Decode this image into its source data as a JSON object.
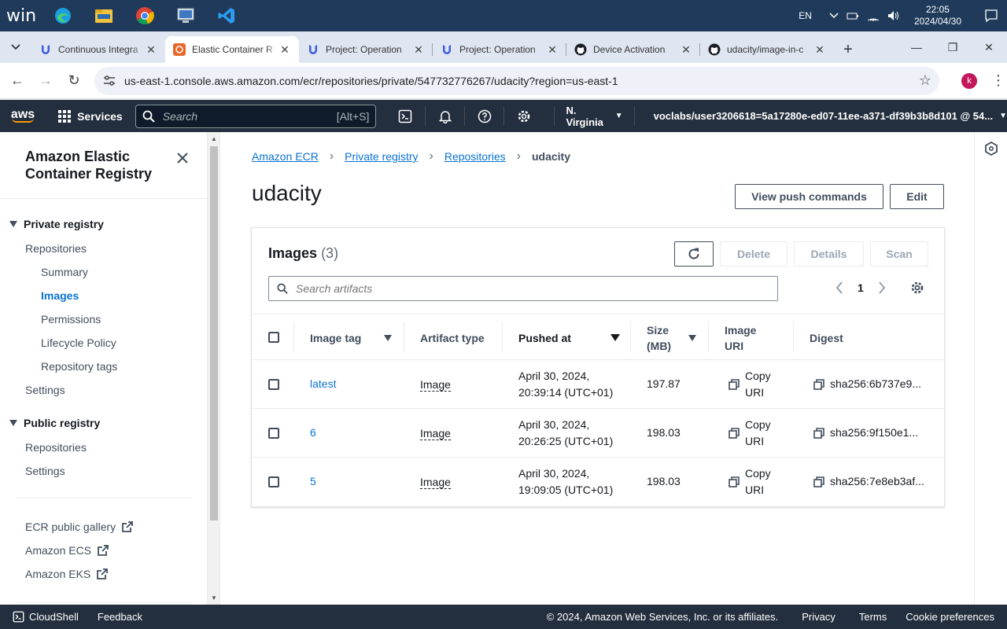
{
  "taskbar": {
    "logo": "win",
    "lang": "EN",
    "time": "22:05",
    "date": "2024/04/30"
  },
  "tabs": [
    {
      "title": "Continuous Integra",
      "icon": "udacity-icon",
      "active": false
    },
    {
      "title": "Elastic Container R",
      "icon": "aws-ecr-icon",
      "active": true
    },
    {
      "title": "Project: Operation",
      "icon": "udacity-icon",
      "active": false
    },
    {
      "title": "Project: Operation",
      "icon": "udacity-icon",
      "active": false
    },
    {
      "title": "Device Activation",
      "icon": "github-icon",
      "active": false
    },
    {
      "title": "udacity/image-in-c",
      "icon": "github-icon",
      "active": false
    }
  ],
  "address": {
    "url": "us-east-1.console.aws.amazon.com/ecr/repositories/private/547732776267/udacity?region=us-east-1",
    "profile_initial": "k"
  },
  "awsnav": {
    "logo": "aws",
    "services": "Services",
    "search_placeholder": "Search",
    "search_hint": "[Alt+S]",
    "region": "N. Virginia",
    "account": "voclabs/user3206618=5a17280e-ed07-11ee-a371-df39b3b8d101 @ 54..."
  },
  "sidebar": {
    "title": "Amazon Elastic Container Registry",
    "private_registry": "Private registry",
    "repositories": "Repositories",
    "summary": "Summary",
    "images": "Images",
    "permissions": "Permissions",
    "lifecycle": "Lifecycle Policy",
    "repo_tags": "Repository tags",
    "settings": "Settings",
    "public_registry": "Public registry",
    "pub_repositories": "Repositories",
    "pub_settings": "Settings",
    "gallery": "ECR public gallery",
    "ecs": "Amazon ECS",
    "eks": "Amazon EKS"
  },
  "breadcrumb": {
    "c1": "Amazon ECR",
    "c2": "Private registry",
    "c3": "Repositories",
    "current": "udacity"
  },
  "page": {
    "title": "udacity",
    "view_push": "View push commands",
    "edit": "Edit"
  },
  "images_panel": {
    "title": "Images",
    "count": "(3)",
    "delete": "Delete",
    "details": "Details",
    "scan": "Scan",
    "search_placeholder": "Search artifacts",
    "page": "1",
    "columns": {
      "tag": "Image tag",
      "artifact": "Artifact type",
      "pushed": "Pushed at",
      "size_1": "Size",
      "size_2": "(MB)",
      "uri_1": "Image",
      "uri_2": "URI",
      "digest": "Digest"
    },
    "rows": [
      {
        "tag": "latest",
        "artifact": "Image",
        "pushed_1": "April 30, 2024,",
        "pushed_2": "20:39:14 (UTC+01)",
        "size": "197.87",
        "copy_1": "Copy",
        "copy_2": "URI",
        "digest": "sha256:6b737e9..."
      },
      {
        "tag": "6",
        "artifact": "Image",
        "pushed_1": "April 30, 2024,",
        "pushed_2": "20:26:25 (UTC+01)",
        "size": "198.03",
        "copy_1": "Copy",
        "copy_2": "URI",
        "digest": "sha256:9f150e1..."
      },
      {
        "tag": "5",
        "artifact": "Image",
        "pushed_1": "April 30, 2024,",
        "pushed_2": "19:09:05 (UTC+01)",
        "size": "198.03",
        "copy_1": "Copy",
        "copy_2": "URI",
        "digest": "sha256:7e8eb3af..."
      }
    ]
  },
  "footer": {
    "cloudshell": "CloudShell",
    "feedback": "Feedback",
    "copyright": "© 2024, Amazon Web Services, Inc. or its affiliates.",
    "privacy": "Privacy",
    "terms": "Terms",
    "cookies": "Cookie preferences"
  },
  "colors": {
    "aws_nav": "#232f3e",
    "link": "#0972d3",
    "aws_orange": "#ff9900"
  }
}
